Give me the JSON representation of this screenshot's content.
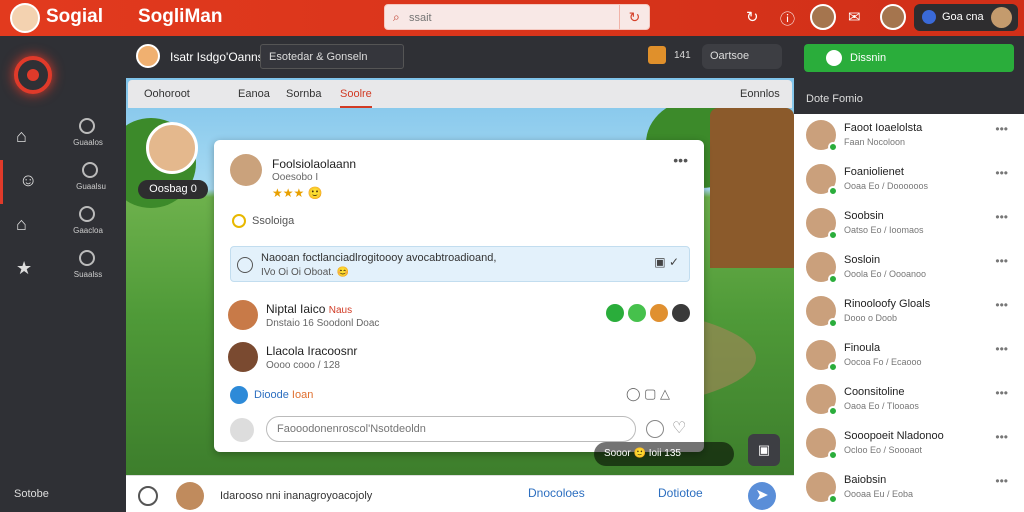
{
  "app": {
    "brand": "Sogial",
    "brand2": "SogliMan"
  },
  "search": {
    "placeholder": "ssait"
  },
  "topbar": {
    "acct_label": "Goa cna"
  },
  "nav": [
    {
      "label": "Guaalos"
    },
    {
      "label": "Guaalsu"
    },
    {
      "label": "Gaacloa"
    },
    {
      "label": "Suaalss"
    }
  ],
  "nav_foot": "Sotobe",
  "chat": {
    "name": "Isatr Isdgo'Oanns",
    "box": "Esotedar & Gonseln",
    "count": "141",
    "btn": "Oartsoe"
  },
  "tabs": [
    "Oohoroot",
    "Eanoa",
    "Sornba",
    "Soolre",
    "Eonnlos"
  ],
  "profile": {
    "badge": "Oosbag 0"
  },
  "post": {
    "name": "Foolsiolaolaann",
    "sub": "Ooesobo I",
    "stars": "★★★ 🙂",
    "tag": "Ssoloiga",
    "msg_l1": "Naooan foctlanciadlrogitoooy avocabtroadioand,",
    "msg_l2": "IVo Oi Oi Oboat. 😊",
    "footer_label": "Dioode",
    "footer_sub": "Ioan",
    "input_placeholder": "Faooodonenroscol'Nsotdeoldn"
  },
  "members": [
    {
      "name": "Niptal Iaico",
      "badge": "Naus",
      "sub": "Dnstaio 16 Soodonl Doac"
    },
    {
      "name": "Llacola Iracoosnr",
      "badge": "",
      "sub": "Oooo cooo / 128"
    }
  ],
  "game": {
    "ctrl": "Sooor 🙂 Ioii 135"
  },
  "bottom": {
    "text": "Idarooso nni inanagroyoacojoly",
    "l1": "Dnocoloes",
    "l2": "Dotiotoe"
  },
  "right": {
    "btn": "Dissnin",
    "hdr": "Dote Fomio",
    "friends": [
      {
        "name": "Faoot Ioaelolsta",
        "sub": "Faan Nocoloon"
      },
      {
        "name": "Foaniolienet",
        "sub": "Ooaa Eo / Doooooos"
      },
      {
        "name": "Soobsin",
        "sub": "Oatso Eo / Ioomaos"
      },
      {
        "name": "Sosloin",
        "sub": "Ooola Eo / Oooanoo"
      },
      {
        "name": "Rinooloofy Gloals",
        "sub": "Dooo o Doob"
      },
      {
        "name": "Finoula",
        "sub": "Oocoa Fo / Ecaooo"
      },
      {
        "name": "Coonsitoline",
        "sub": "Oaoa Eo / Tlooaos"
      },
      {
        "name": "Sooopoeit Nladonoo",
        "sub": "Ocloo Eo / Soooaot"
      },
      {
        "name": "Baiobsin",
        "sub": "Oooaa Eu / Eoba"
      }
    ]
  }
}
